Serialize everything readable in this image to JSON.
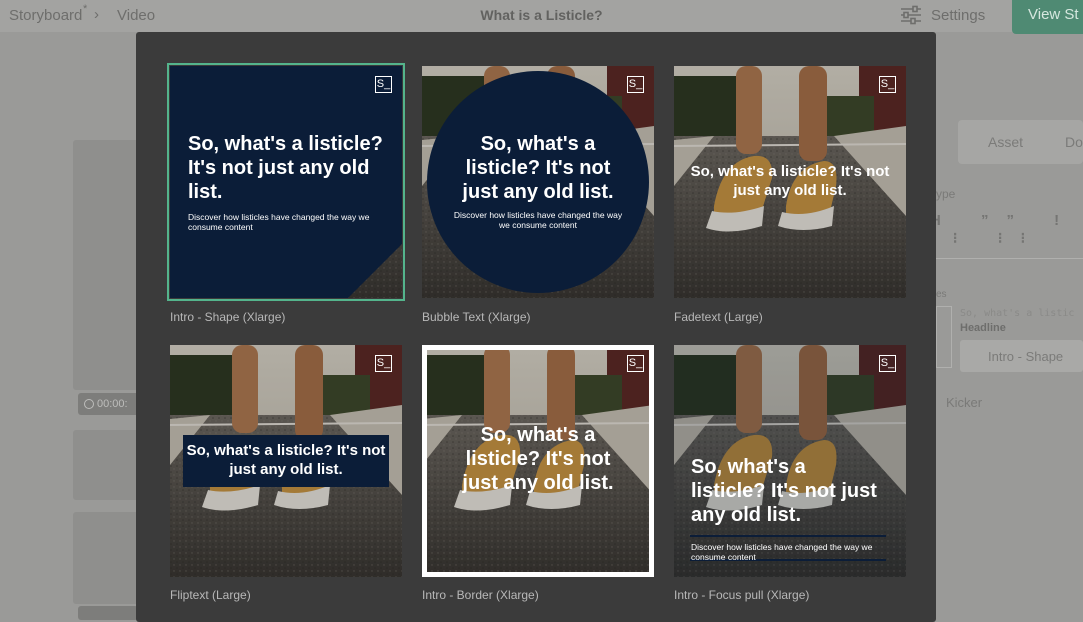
{
  "topbar": {
    "breadcrumb_1": "Storyboard",
    "breadcrumb_1_mark": "*",
    "breadcrumb_sep": "›",
    "breadcrumb_2": "Video",
    "title": "What is a Listicle?",
    "settings_label": "Settings",
    "view_button_label": "View St"
  },
  "background": {
    "timecode": "00:00:",
    "right_panel": {
      "tab_asset": "Asset",
      "tab_do": "Do",
      "type_label": "ype",
      "toolbar": "H ”” ! ⁝⁝ ⁝⁝",
      "section_label": "es",
      "headline_value": "So, what's a listic",
      "headline_label": "Headline",
      "select_value": "Intro - Shape",
      "kicker_label": "Kicker"
    }
  },
  "modal": {
    "logo_text": "S_",
    "headline": "So, what's a listicle? It's not just any old list.",
    "subtext": "Discover how listicles have changed the way we consume content",
    "templates": [
      {
        "label": "Intro - Shape (Xlarge)",
        "selected": true
      },
      {
        "label": "Bubble Text (Xlarge)",
        "selected": false
      },
      {
        "label": "Fadetext (Large)",
        "selected": false
      },
      {
        "label": "Fliptext (Large)",
        "selected": false
      },
      {
        "label": "Intro - Border (Xlarge)",
        "selected": false
      },
      {
        "label": "Intro - Focus pull (Xlarge)",
        "selected": false
      }
    ]
  },
  "colors": {
    "navy": "#0b1d38",
    "accent_selected": "#54b48c",
    "modal_bg": "#3b3b3b",
    "green_button": "#4f8a73"
  }
}
